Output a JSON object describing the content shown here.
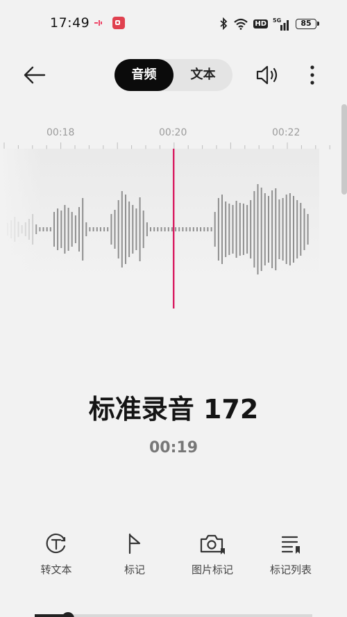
{
  "status_bar": {
    "time": "17:49",
    "network": "5G",
    "hd_label": "HD",
    "battery": "85",
    "icons": [
      "app-notification-icon",
      "screen-record-icon",
      "bluetooth-icon",
      "wifi-icon",
      "signal-icon",
      "battery-icon"
    ]
  },
  "header": {
    "tabs": [
      {
        "label": "音频",
        "active": true
      },
      {
        "label": "文本",
        "active": false
      }
    ],
    "icons": [
      "back-arrow-icon",
      "speaker-icon",
      "more-vertical-icon"
    ]
  },
  "timeline": {
    "labels": [
      "00:18",
      "00:20",
      "00:22"
    ],
    "playhead_color": "#d81b60"
  },
  "recording": {
    "title": "标准录音 172",
    "elapsed": "00:19"
  },
  "actions": [
    {
      "label": "转文本",
      "icon": "transcribe-icon"
    },
    {
      "label": "标记",
      "icon": "flag-icon"
    },
    {
      "label": "图片标记",
      "icon": "camera-mark-icon"
    },
    {
      "label": "标记列表",
      "icon": "mark-list-icon"
    }
  ],
  "colors": {
    "accent": "#d81b60",
    "active_tab": "#0b0b0b",
    "background": "#f2f2f2"
  }
}
